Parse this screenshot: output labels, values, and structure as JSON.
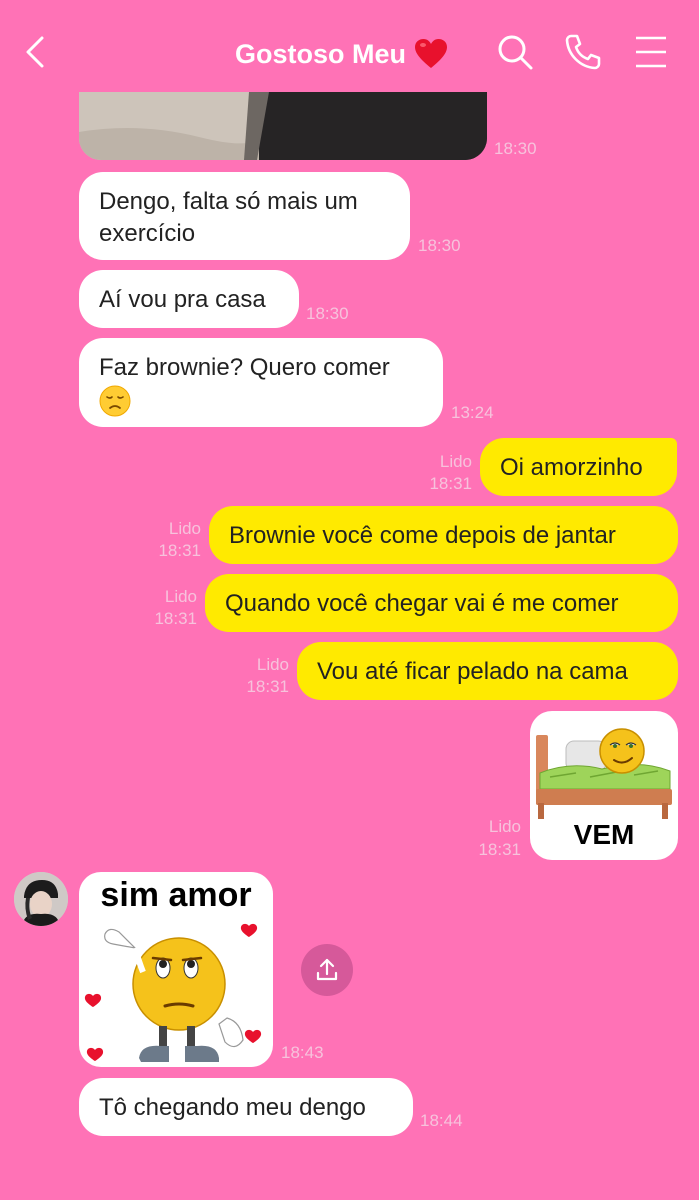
{
  "header": {
    "title": "Gostoso Meu",
    "title_emoji": "heart-icon",
    "icons": [
      "back-icon",
      "search-icon",
      "phone-icon",
      "menu-icon"
    ]
  },
  "messages": {
    "photo_time": "18:30",
    "m1": {
      "text_line1": "Dengo, falta só mais um",
      "text_line2": "exercício",
      "time": "18:30"
    },
    "m2": {
      "text": "Aí vou pra casa",
      "time": "18:30"
    },
    "m3": {
      "text_line1": "Faz brownie? Quero comer",
      "emoji": "disappointed-face",
      "time": "13:24"
    },
    "m4": {
      "text": "Oi amorzinho",
      "read": "Lido",
      "time": "18:31"
    },
    "m5": {
      "text": "Brownie você come depois de jantar",
      "read": "Lido",
      "time": "18:31"
    },
    "m6": {
      "text": "Quando você chegar vai é me comer",
      "read": "Lido",
      "time": "18:31"
    },
    "m7": {
      "text": "Vou até ficar pelado na cama",
      "read": "Lido",
      "time": "18:31"
    },
    "sticker_out": {
      "caption": "VEM",
      "read": "Lido",
      "time": "18:31"
    },
    "sticker_in": {
      "caption": "sim amor",
      "time": "18:43"
    },
    "m8": {
      "text": "Tô chegando meu dengo",
      "time": "18:44"
    }
  },
  "colors": {
    "background": "#ff72b6",
    "incoming_bubble": "#ffffff",
    "outgoing_bubble": "#ffea00",
    "timestamp": "#f7c2dc"
  }
}
